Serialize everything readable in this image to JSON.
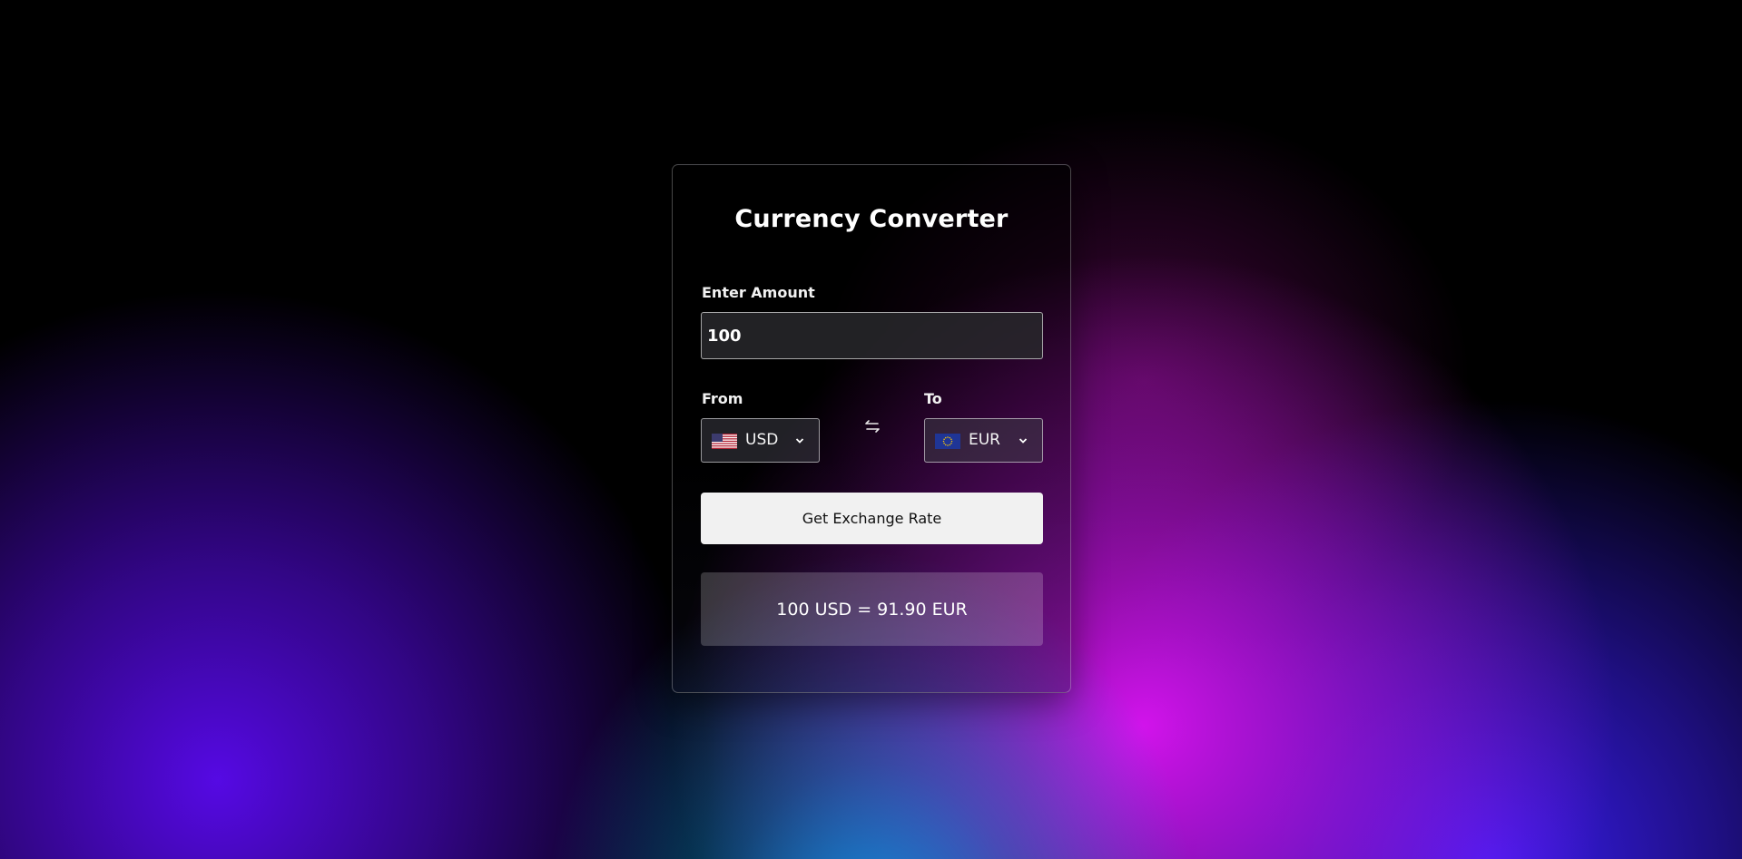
{
  "converter": {
    "title": "Currency Converter",
    "amount_label": "Enter Amount",
    "amount_value": "100",
    "from_label": "From",
    "to_label": "To",
    "from_currency": {
      "code": "USD",
      "flag_icon": "us-flag-icon"
    },
    "to_currency": {
      "code": "EUR",
      "flag_icon": "eu-flag-icon"
    },
    "swap_icon": "swap-arrows-icon",
    "button_label": "Get Exchange Rate",
    "result_text": "100 USD = 91.90 EUR"
  },
  "colors": {
    "card_border": "#ffffff",
    "button_background": "#f1f1f1",
    "button_text": "#111111",
    "bg_blue": "#0e96e6",
    "bg_magenta": "#dc14f5",
    "bg_violet": "#5a0af0"
  }
}
